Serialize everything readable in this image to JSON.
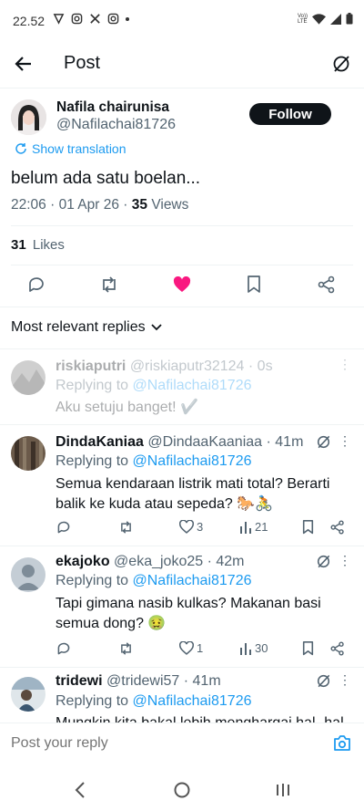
{
  "status_bar": {
    "time": "22.52",
    "network": "Vo))\nLTE"
  },
  "header": {
    "title": "Post"
  },
  "post": {
    "author_name": "Nafila chairunisa",
    "author_handle": "@Nafilachai81726",
    "follow_label": "Follow",
    "show_translation": "Show translation",
    "text": "belum ada satu boelan...",
    "time": "22:06",
    "date": "01 Apr 26",
    "separator": "·",
    "views_count": "35",
    "views_label": "Views",
    "likes_count": "31",
    "likes_label": "Likes",
    "like_color": "#f91880"
  },
  "replies_filter": {
    "label": "Most relevant replies"
  },
  "replies": [
    {
      "name": "riskiaputri",
      "handle": "@riskiaputr32124",
      "time": "· 0s",
      "replying_prefix": "Replying to",
      "replying_to": "@Nafilachai81726",
      "text": "Aku setuju banget! ✔️"
    },
    {
      "name": "DindaKaniaa",
      "handle": "@DindaaKaaniaa",
      "time": "· 41m",
      "replying_prefix": "Replying to",
      "replying_to": "@Nafilachai81726",
      "text_line1": "Semua kendaraan listrik mati total? Berarti",
      "text_line2": "balik ke kuda atau sepeda? 🐎🚴",
      "likes": "3",
      "views": "21"
    },
    {
      "name": "ekajoko",
      "handle": "@eka_joko25",
      "time": "· 42m",
      "replying_prefix": "Replying to",
      "replying_to": "@Nafilachai81726",
      "text_line1": "Tapi gimana nasib kulkas? Makanan basi",
      "text_line2": "semua dong? 🤢",
      "likes": "1",
      "views": "30"
    },
    {
      "name": "tridewi",
      "handle": "@tridewi57",
      "time": "· 41m",
      "replying_prefix": "Replying to",
      "replying_to": "@Nafilachai81726",
      "text_line1": "Mungkin kita bakal lebih menghargai hal- hal"
    }
  ],
  "compose": {
    "placeholder": "Post your reply"
  }
}
